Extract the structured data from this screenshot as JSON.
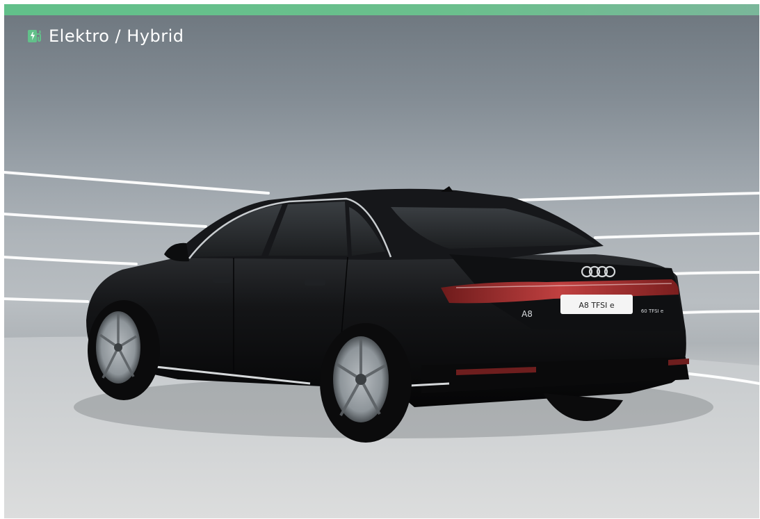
{
  "badge": {
    "icon": "ev-charger-icon",
    "label": "Elektro / Hybrid"
  },
  "vehicle": {
    "brand_badge": "A8",
    "license_plate": "A8 TFSI e",
    "trunk_badge": "60 TFSI e"
  },
  "colors": {
    "accent": "#62c08a",
    "car_body": "#111214"
  }
}
